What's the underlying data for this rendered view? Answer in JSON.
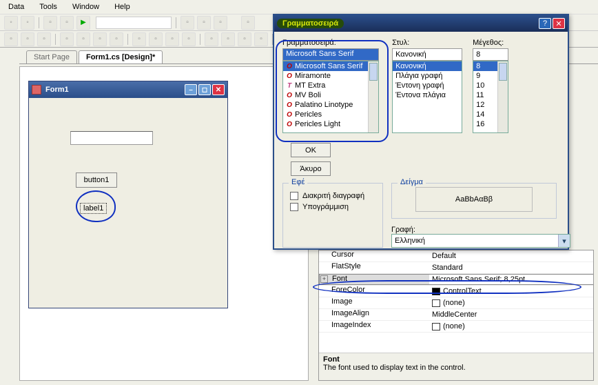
{
  "menu": {
    "data": "Data",
    "tools": "Tools",
    "window": "Window",
    "help": "Help"
  },
  "tabs": {
    "start": "Start Page",
    "design": "Form1.cs [Design]*"
  },
  "form": {
    "title": "Form1",
    "button": "button1",
    "label": "label1"
  },
  "props": {
    "cursor_l": "Cursor",
    "cursor_v": "Default",
    "flat_l": "FlatStyle",
    "flat_v": "Standard",
    "font_l": "Font",
    "font_v": "Microsoft Sans Serif; 8,25pt",
    "fore_l": "ForeColor",
    "fore_v": "ControlText",
    "img_l": "Image",
    "img_v": "(none)",
    "align_l": "ImageAlign",
    "align_v": "MiddleCenter",
    "idx_l": "ImageIndex",
    "idx_v": "(none)",
    "desc_t": "Font",
    "desc_b": "The font used to display text in the control."
  },
  "dlg": {
    "title": "Γραμματοσειρά",
    "font_lbl": "Γραμματοσειρά:",
    "font_val": "Microsoft Sans Serif",
    "style_lbl": "Στυλ:",
    "style_val": "Κανονική",
    "size_lbl": "Μέγεθος:",
    "size_val": "8",
    "ok": "OK",
    "cancel": "Άκυρο",
    "fonts": [
      "Microsoft Sans Serif",
      "Miramonte",
      "MT Extra",
      "MV Boli",
      "Palatino Linotype",
      "Pericles",
      "Pericles Light"
    ],
    "styles": [
      "Κανονική",
      "Πλάγια γραφή",
      "Έντονη γραφή",
      "Έντονα πλάγια"
    ],
    "sizes": [
      "8",
      "9",
      "10",
      "11",
      "12",
      "14",
      "16"
    ],
    "effects_t": "Εφέ",
    "strike": "Διακριτή διαγραφή",
    "underline": "Υπογράμμιση",
    "sample_t": "Δείγμα",
    "sample": "AaBbΑαΒβ",
    "script_t": "Γραφή:",
    "script_v": "Ελληνική"
  }
}
